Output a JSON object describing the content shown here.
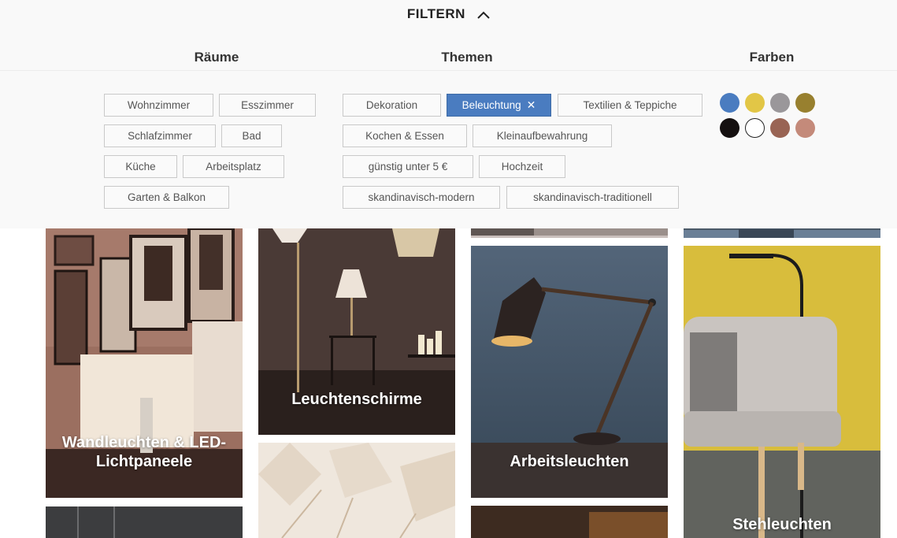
{
  "filter": {
    "toggle_label": "FILTERN",
    "columns": {
      "rooms": "Räume",
      "themes": "Themen",
      "colors": "Farben"
    },
    "rooms": [
      "Wohnzimmer",
      "Esszimmer",
      "Schlafzimmer",
      "Bad",
      "Küche",
      "Arbeitsplatz",
      "Garten & Balkon"
    ],
    "themes": [
      "Dekoration",
      "Beleuchtung",
      "Textilien & Teppiche",
      "Kochen & Essen",
      "Kleinaufbewahrung",
      "günstig unter 5 €",
      "Hochzeit",
      "skandinavisch-modern",
      "skandinavisch-traditionell"
    ],
    "active_theme": "Beleuchtung",
    "colors": [
      {
        "name": "blue",
        "hex": "#4a7cc0"
      },
      {
        "name": "yellow",
        "hex": "#e2c646"
      },
      {
        "name": "grey",
        "hex": "#9a979a"
      },
      {
        "name": "olive",
        "hex": "#98802f"
      },
      {
        "name": "black",
        "hex": "#151010"
      },
      {
        "name": "white",
        "hex": "#ffffff"
      },
      {
        "name": "brown",
        "hex": "#996454"
      },
      {
        "name": "pink",
        "hex": "#c48a7a"
      }
    ]
  },
  "tiles": {
    "wall_lights": "Wandleuchten & LED-Lichtpaneele",
    "lampshades": "Leuchtenschirme",
    "work_lamps": "Arbeitsleuchten",
    "floor_lamps": "Stehleuchten"
  }
}
